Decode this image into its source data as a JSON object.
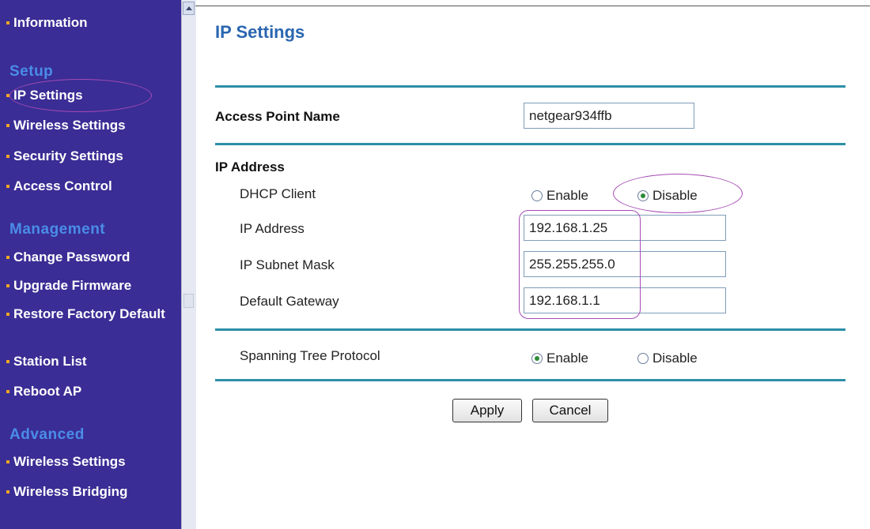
{
  "sidebar": {
    "top_item": "Information",
    "sections": {
      "setup": "Setup",
      "management": "Management",
      "advanced": "Advanced"
    },
    "setup_items": [
      "IP Settings",
      "Wireless Settings",
      "Security Settings",
      "Access Control"
    ],
    "management_items": [
      "Change Password",
      "Upgrade Firmware",
      "Restore Factory Default",
      "Station List",
      "Reboot AP"
    ],
    "advanced_items": [
      "Wireless Settings",
      "Wireless Bridging"
    ],
    "selected": "IP Settings"
  },
  "main": {
    "title": "IP Settings",
    "access_point_name_label": "Access Point Name",
    "access_point_name_value": "netgear934ffb",
    "ip_address_heading": "IP Address",
    "dhcp_client_label": "DHCP Client",
    "dhcp_enable_label": "Enable",
    "dhcp_disable_label": "Disable",
    "dhcp_selected": "Disable",
    "ip_address_label": "IP Address",
    "ip_address_value": "192.168.1.25",
    "subnet_mask_label": "IP Subnet Mask",
    "subnet_mask_value": "255.255.255.0",
    "gateway_label": "Default Gateway",
    "gateway_value": "192.168.1.1",
    "stp_label": "Spanning Tree Protocol",
    "stp_enable_label": "Enable",
    "stp_disable_label": "Disable",
    "stp_selected": "Enable",
    "apply_label": "Apply",
    "cancel_label": "Cancel"
  },
  "colors": {
    "sidebar_bg": "#3a2d95",
    "section_heading": "#4a8de8",
    "bullet": "#f5a623",
    "title": "#2a66b0",
    "rule": "#2d8fa8",
    "annotation": "#a64bb5"
  }
}
